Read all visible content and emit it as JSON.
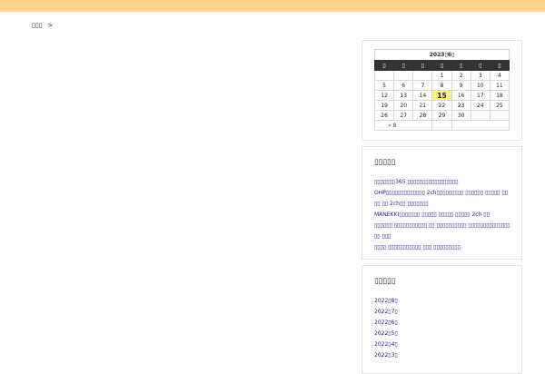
{
  "breadcrumb": {
    "home": "▯▯▯",
    "separator": ">"
  },
  "calendar": {
    "caption": "2023▯6▯",
    "weekdays": [
      "▯",
      "▯",
      "▯",
      "▯",
      "▯",
      "▯",
      "▯"
    ],
    "weeks": [
      [
        "",
        "",
        "",
        "1",
        "2",
        "3",
        "4"
      ],
      [
        "5",
        "6",
        "7",
        "8",
        "9",
        "10",
        "11"
      ],
      [
        "12",
        "13",
        "14",
        "15",
        "16",
        "17",
        "18"
      ],
      [
        "19",
        "20",
        "21",
        "22",
        "23",
        "24",
        "25"
      ],
      [
        "26",
        "27",
        "28",
        "29",
        "30",
        "",
        ""
      ]
    ],
    "today": "15",
    "prev_link": "« 8"
  },
  "recent_posts": {
    "title": "▯▯▯▯▯",
    "items": [
      "▯▯▯▯▯▯▯365 ▯▯▯▯▯▯▯▯▯▯▯▯▯▯▯▯▯",
      "OHP▯▯▯▯▯▯▯▯▯▯▯▯▯ 2ch▯▯▯▯▯▯▯▯▯ ▯▯▯▯▯▯ ▯▯▯▯▯ ▯▯ ▯▯ ▯▯ 2ch▯▯ ▯▯▯▯▯▯▯",
      "MANEKKI▯▯▯▯▯▯▯ ▯▯▯▯▯ ▯▯▯▯▯ ▯▯▯▯▯ 2ch ▯▯",
      "▯▯▯▯▯▯ ▯▯▯▯▯▯▯▯▯▯▯ ▯▯ ▯▯▯▯▯▯▯▯▯▯ ▯▯▯▯▯▯▯▯▯▯▯▯▯▯ ▯▯ ▯▯▯",
      "▯▯▯▯ ▯▯▯▯▯▯▯▯▯▯▯ ▯▯▯ ▯▯▯▯▯▯▯▯▯"
    ]
  },
  "archives": {
    "title": "▯▯▯▯▯",
    "items": [
      "2022▯8▯",
      "2022▯7▯",
      "2022▯6▯",
      "2022▯5▯",
      "2022▯4▯",
      "2022▯3▯"
    ]
  }
}
